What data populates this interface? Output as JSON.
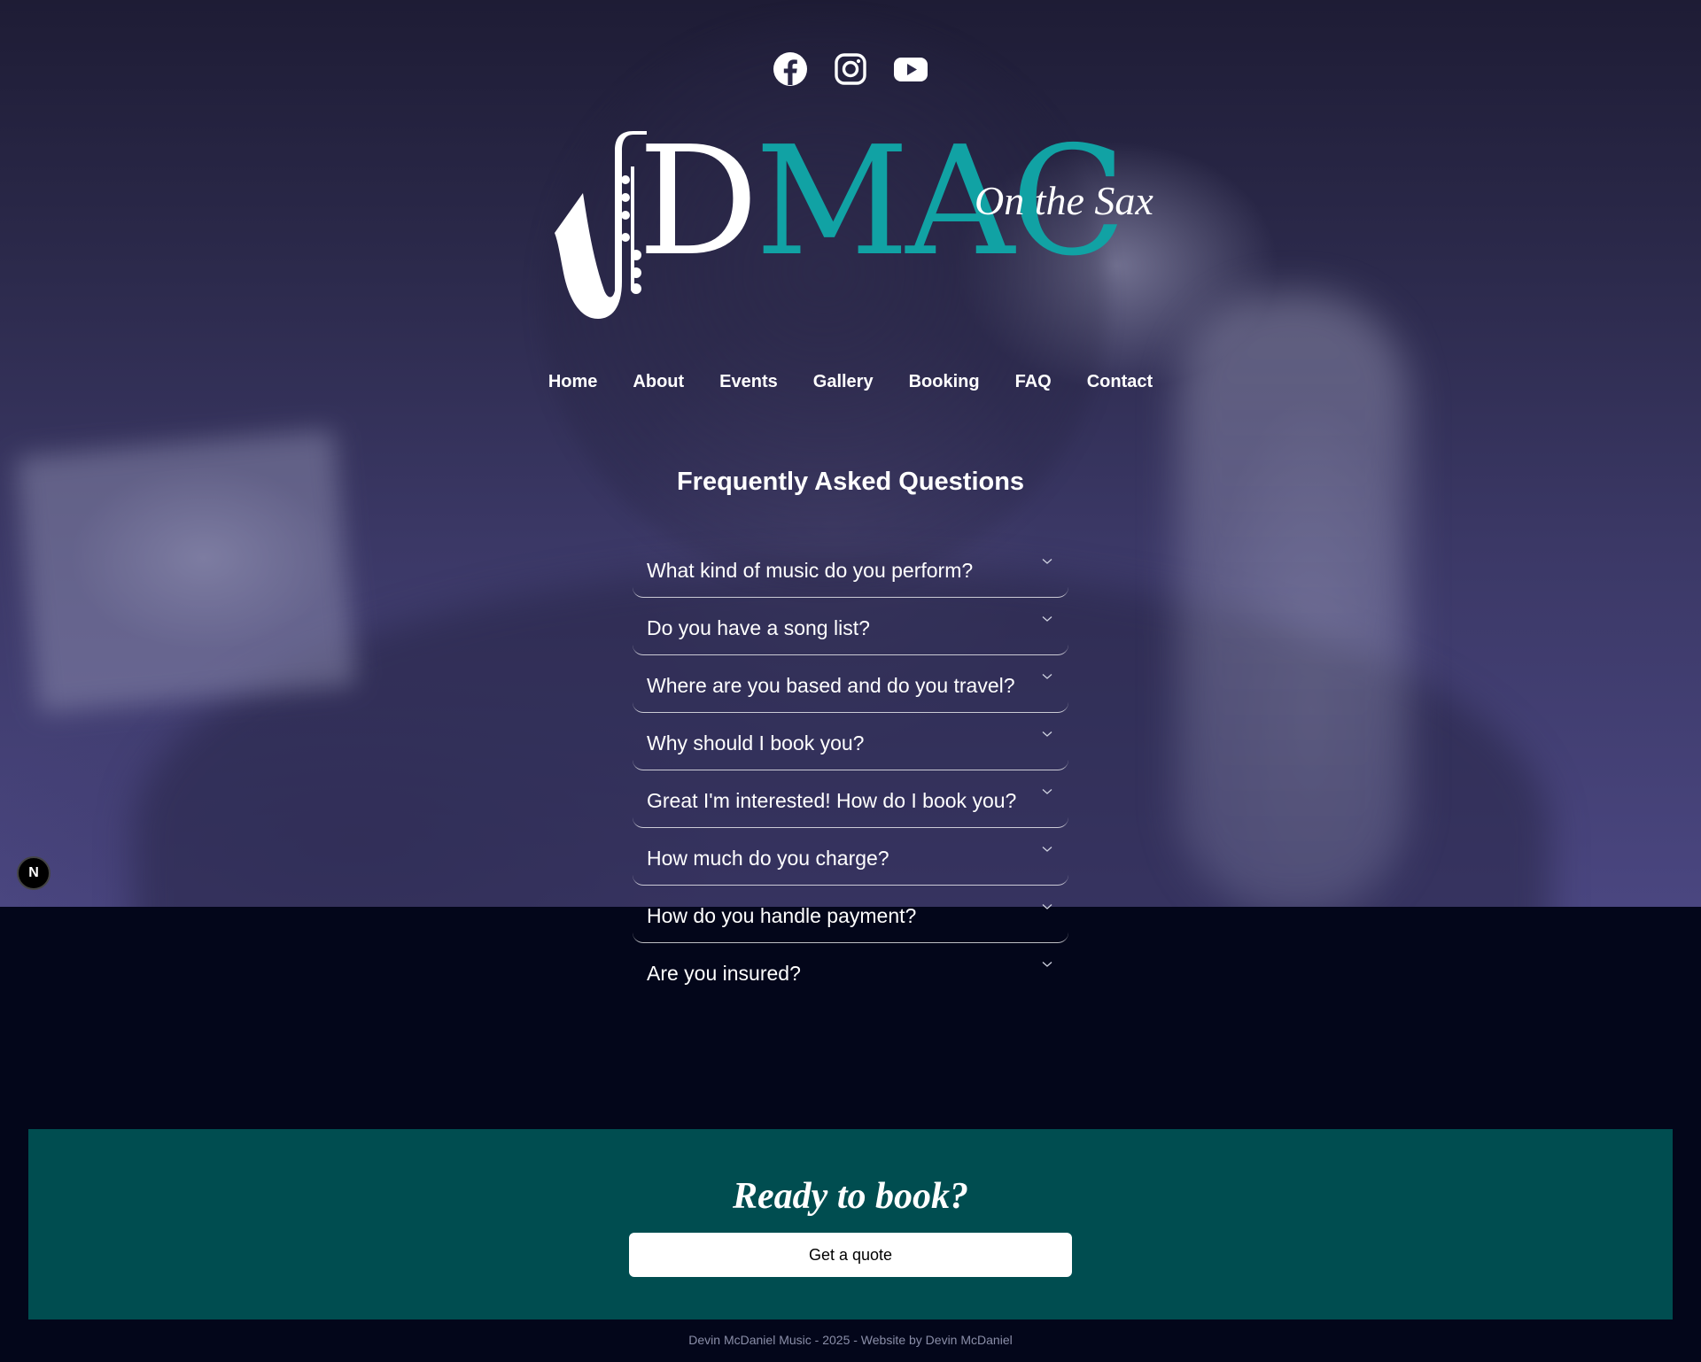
{
  "social": {
    "icons": [
      "facebook-icon",
      "instagram-icon",
      "youtube-icon"
    ]
  },
  "logo": {
    "letters_d": "D",
    "letters_mac": "MAC",
    "tagline": "On the Sax",
    "accent_color": "#11a2a4"
  },
  "nav": {
    "items": [
      "Home",
      "About",
      "Events",
      "Gallery",
      "Booking",
      "FAQ",
      "Contact"
    ]
  },
  "faq": {
    "title": "Frequently Asked Questions",
    "questions": [
      "What kind of music do you perform?",
      "Do you have a song list?",
      "Where are you based and do you travel?",
      "Why should I book you?",
      "Great I'm interested! How do I book you?",
      "How much do you charge?",
      "How do you handle payment?",
      "Are you insured?"
    ]
  },
  "badge": {
    "label": "N"
  },
  "cta": {
    "heading": "Ready to book?",
    "button_label": "Get a quote",
    "background_color": "#004d50"
  },
  "footer": {
    "text": "Devin McDaniel Music - 2025 - Website by Devin McDaniel"
  }
}
